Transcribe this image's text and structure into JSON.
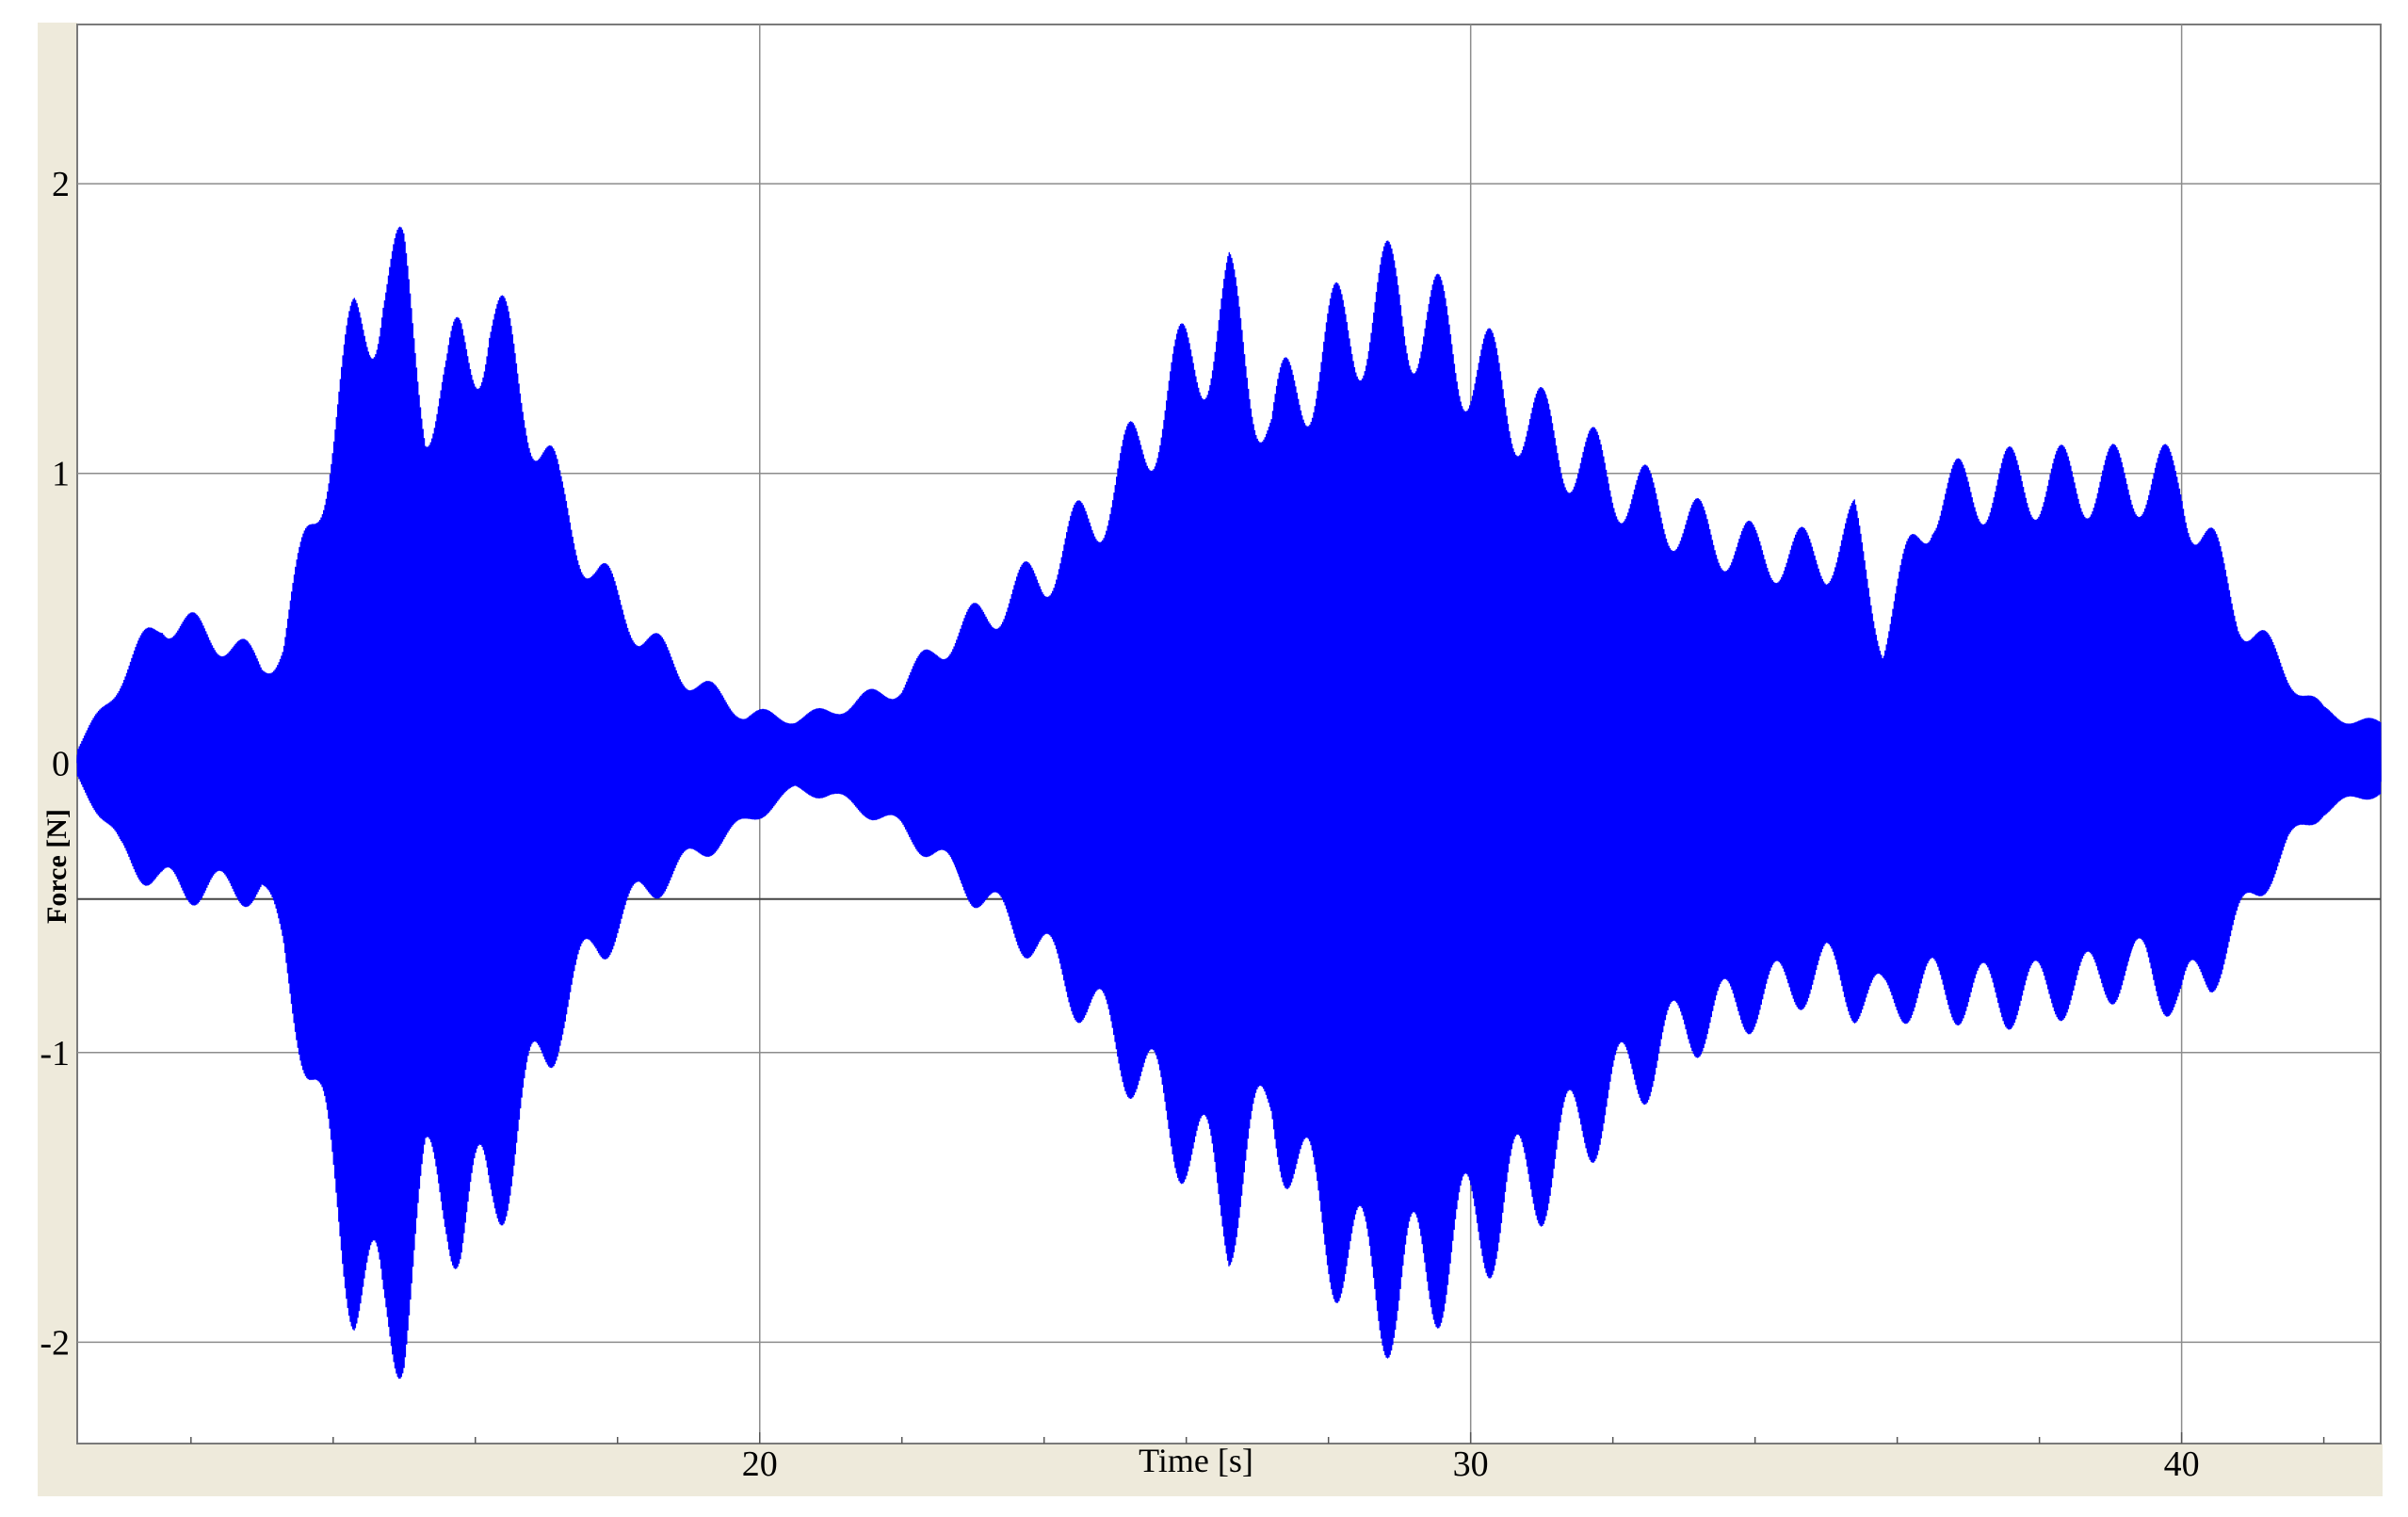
{
  "chart_data": {
    "type": "line",
    "title": "",
    "xlabel": "Time [s]",
    "ylabel": "Force [N]",
    "xlim": [
      10.4,
      42.8
    ],
    "ylim": [
      -2.35,
      2.55
    ],
    "x_ticks": [
      20,
      30,
      40
    ],
    "y_ticks": [
      2,
      1,
      0,
      -1,
      -2
    ],
    "x_tick_labels": [
      "20",
      "30",
      "40"
    ],
    "y_tick_labels": [
      "2",
      "1",
      "0",
      "-1",
      "-2"
    ],
    "grid": true,
    "reference_line_y": -0.47,
    "series": [
      {
        "color": "#0000ff",
        "envelope": {
          "t": [
            10.4,
            10.6,
            11.0,
            11.6,
            12.3,
            13.0,
            13.3,
            13.8,
            14.3,
            14.7,
            15.0,
            15.3,
            15.6,
            15.8,
            16.2,
            16.7,
            17.2,
            17.7,
            18.3,
            19.0,
            19.8,
            20.5,
            21.0,
            21.5,
            22.0,
            22.5,
            23.0,
            24.0,
            25.0,
            26.0,
            26.6,
            27.2,
            27.8,
            28.5,
            29.0,
            30.0,
            31.0,
            32.0,
            33.0,
            34.0,
            35.0,
            35.4,
            35.8,
            36.5,
            37.5,
            38.5,
            39.5,
            40.0,
            40.4,
            40.8,
            41.5,
            42.0,
            42.8
          ],
          "upper": [
            0.05,
            0.15,
            0.35,
            0.6,
            0.55,
            0.45,
            0.55,
            1.3,
            2.0,
            2.35,
            2.2,
            1.7,
            1.7,
            1.85,
            1.95,
            1.6,
            1.1,
            0.8,
            0.55,
            0.35,
            0.2,
            0.17,
            0.2,
            0.25,
            0.3,
            0.45,
            0.55,
            0.75,
            1.1,
            1.6,
            1.85,
            1.4,
            1.7,
            1.95,
            2.05,
            1.85,
            1.6,
            1.3,
            1.05,
            0.9,
            0.85,
            0.95,
            0.55,
            1.05,
            1.1,
            1.1,
            1.1,
            1.1,
            0.85,
            0.6,
            0.35,
            0.2,
            0.15
          ],
          "lower": [
            -0.05,
            -0.15,
            -0.35,
            -0.5,
            -0.5,
            -0.5,
            -0.7,
            -1.4,
            -2.0,
            -2.25,
            -2.1,
            -1.7,
            -1.7,
            -1.8,
            -1.75,
            -1.4,
            -1.0,
            -0.75,
            -0.55,
            -0.4,
            -0.25,
            -0.12,
            -0.15,
            -0.22,
            -0.3,
            -0.45,
            -0.6,
            -0.85,
            -1.2,
            -1.6,
            -1.85,
            -1.4,
            -1.8,
            -2.05,
            -2.1,
            -1.85,
            -1.6,
            -1.3,
            -1.05,
            -0.95,
            -0.85,
            -0.95,
            -0.95,
            -0.98,
            -1.05,
            -1.05,
            -1.0,
            -1.1,
            -0.95,
            -0.7,
            -0.35,
            -0.2,
            -0.12
          ]
        }
      }
    ]
  }
}
